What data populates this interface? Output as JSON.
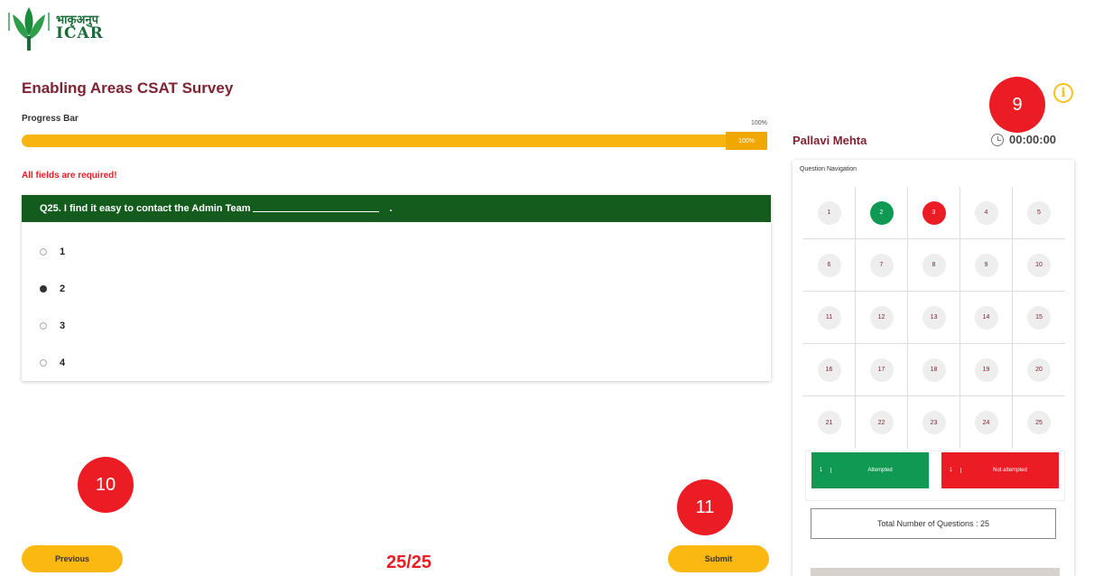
{
  "logo": {
    "hindi": "भाकृअनुप",
    "english": "ICAR"
  },
  "survey": {
    "title": "Enabling Areas CSAT Survey"
  },
  "progress": {
    "label": "Progress Bar",
    "percent_text": "100%",
    "badge_text": "100%",
    "fraction": 1.0
  },
  "required_message": "All fields are required!",
  "question": {
    "text": "Q25. I find it easy to contact the Admin Team",
    "trailing": ".",
    "options": [
      "1",
      "2",
      "3",
      "4"
    ],
    "selected": "2"
  },
  "markers": {
    "m9": "9",
    "m10": "10",
    "m11": "11"
  },
  "buttons": {
    "previous": "Previous",
    "submit": "Submit"
  },
  "page_counter": "25/25",
  "user": {
    "name": "Pallavi Mehta"
  },
  "timer": "00:00:00",
  "info_icon_glyph": "i",
  "navigation": {
    "title": "Question Navigation",
    "questions": [
      {
        "n": "1",
        "state": "none"
      },
      {
        "n": "2",
        "state": "attempted"
      },
      {
        "n": "3",
        "state": "not-attempted"
      },
      {
        "n": "4",
        "state": "none"
      },
      {
        "n": "5",
        "state": "none"
      },
      {
        "n": "6",
        "state": "none"
      },
      {
        "n": "7",
        "state": "none"
      },
      {
        "n": "8",
        "state": "none"
      },
      {
        "n": "9",
        "state": "none"
      },
      {
        "n": "10",
        "state": "none"
      },
      {
        "n": "11",
        "state": "none"
      },
      {
        "n": "12",
        "state": "none"
      },
      {
        "n": "13",
        "state": "none"
      },
      {
        "n": "14",
        "state": "none"
      },
      {
        "n": "15",
        "state": "none"
      },
      {
        "n": "16",
        "state": "none"
      },
      {
        "n": "17",
        "state": "none"
      },
      {
        "n": "18",
        "state": "none"
      },
      {
        "n": "19",
        "state": "none"
      },
      {
        "n": "20",
        "state": "none"
      },
      {
        "n": "21",
        "state": "none"
      },
      {
        "n": "22",
        "state": "none"
      },
      {
        "n": "23",
        "state": "none"
      },
      {
        "n": "24",
        "state": "none"
      },
      {
        "n": "25",
        "state": "none"
      }
    ],
    "legend": {
      "attempted_count": "1",
      "attempted_label": "Attempted",
      "not_attempted_count": "1",
      "not_attempted_label": "Not attempted"
    },
    "total_label": "Total Number of Questions : 25"
  },
  "colors": {
    "brand_maroon": "#7d2331",
    "accent_yellow": "#f8b510",
    "question_green": "#145c1e",
    "attempted_green": "#0f9952",
    "alert_red": "#ec1c24"
  }
}
